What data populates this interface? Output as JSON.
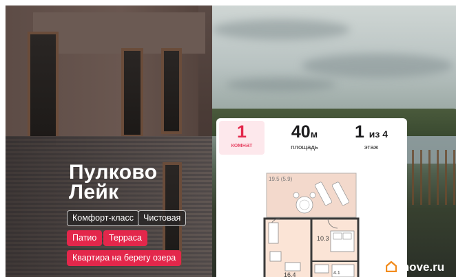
{
  "project": {
    "title_line1": "Пулково",
    "title_line2": "Лейк"
  },
  "tags": {
    "class_label": "Комфорт-класс",
    "finish_label": "Чистовая",
    "patio_label": "Патио",
    "terrace_label": "Терраса",
    "lakeside_label": "Квартира на берегу озера"
  },
  "stats": {
    "rooms_value": "1",
    "rooms_label": "комнат",
    "area_value": "40",
    "area_unit": "м",
    "area_label": "площадь",
    "floor_value": "1",
    "floor_total": "из 4",
    "floor_label": "этаж"
  },
  "floorplan": {
    "terrace_area": "19.5 (5.9)",
    "bedroom_area": "10.3",
    "living_area": "16.4",
    "bath_area": "4.1"
  },
  "watermark": {
    "brand": "move.ru"
  },
  "colors": {
    "accent": "#e3274b",
    "accent_light": "#fde8ec",
    "watermark_icon": "#f28c1e"
  }
}
